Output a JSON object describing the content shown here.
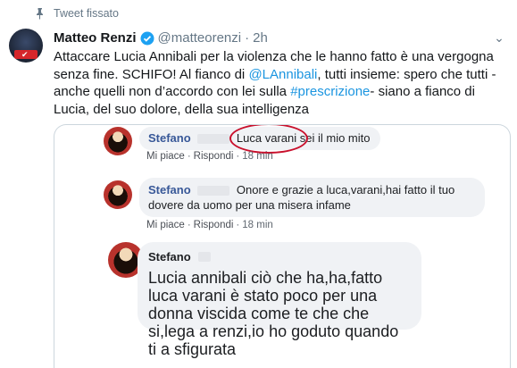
{
  "pinned": {
    "label": "Tweet fissato",
    "icon": "pin-icon"
  },
  "tweet": {
    "author_name": "Matteo Renzi",
    "verified_icon": "verified-icon",
    "handle": "@matteorenzi",
    "separator": "·",
    "time": "2h",
    "text": {
      "part1": "Attaccare Lucia Annibali per la violenza che le hanno fatto è una vergogna senza fine. SCHIFO! Al fianco di ",
      "mention": "@LAnnibali",
      "part2": ", tutti insieme: spero che tutti - anche quelli non d’accordo con lei sulla ",
      "hashtag": "#prescrizione",
      "part3": "-  siano a fianco di Lucia, del suo dolore, della sua intelligenza"
    }
  },
  "media": {
    "comments": [
      {
        "name": "Stefano",
        "text": "Luca varani sei il mio mito",
        "like": "Mi piace",
        "reply": "Rispondi",
        "dot": "·",
        "time": "18 min"
      },
      {
        "name": "Stefano",
        "text": "Onore e grazie a luca,varani,hai fatto il tuo dovere da uomo per una misera infame",
        "like": "Mi piace",
        "reply": "Rispondi",
        "dot": "·",
        "time": "18 min"
      },
      {
        "name": "Stefano",
        "text": "Lucia annibali ciò che ha,ha,fatto luca varani è stato poco per una donna viscida come te che che si,lega a renzi,io ho goduto quando ti a sfigurata"
      }
    ]
  },
  "colors": {
    "link": "#1b95e0",
    "highlight_circle": "#c9102c",
    "bubble_bg": "#f0f2f5"
  }
}
